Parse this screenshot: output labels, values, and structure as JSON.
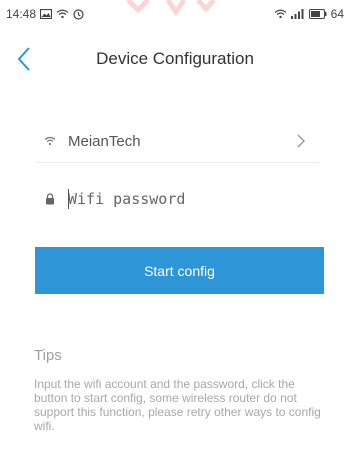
{
  "status_bar": {
    "time": "14:48",
    "battery": "64",
    "icons_left": [
      "image-icon",
      "wifi-icon",
      "alarm-icon"
    ],
    "icons_right": [
      "wifi-icon",
      "signal-icon",
      "battery-icon"
    ]
  },
  "header": {
    "title": "Device Configuration",
    "back_icon": "chevron-left-icon"
  },
  "form": {
    "ssid": "MeianTech",
    "password_placeholder": "Wifi password",
    "password_value": ""
  },
  "actions": {
    "start_label": "Start config"
  },
  "tips": {
    "title": "Tips",
    "body": "Input the wifi account and the password, click the button to start config, some wireless router do not support this function, please retry other ways to config wifi."
  },
  "colors": {
    "accent": "#2e96d6",
    "back_icon": "#2e96d6",
    "tips_text": "#a8a8a8"
  }
}
